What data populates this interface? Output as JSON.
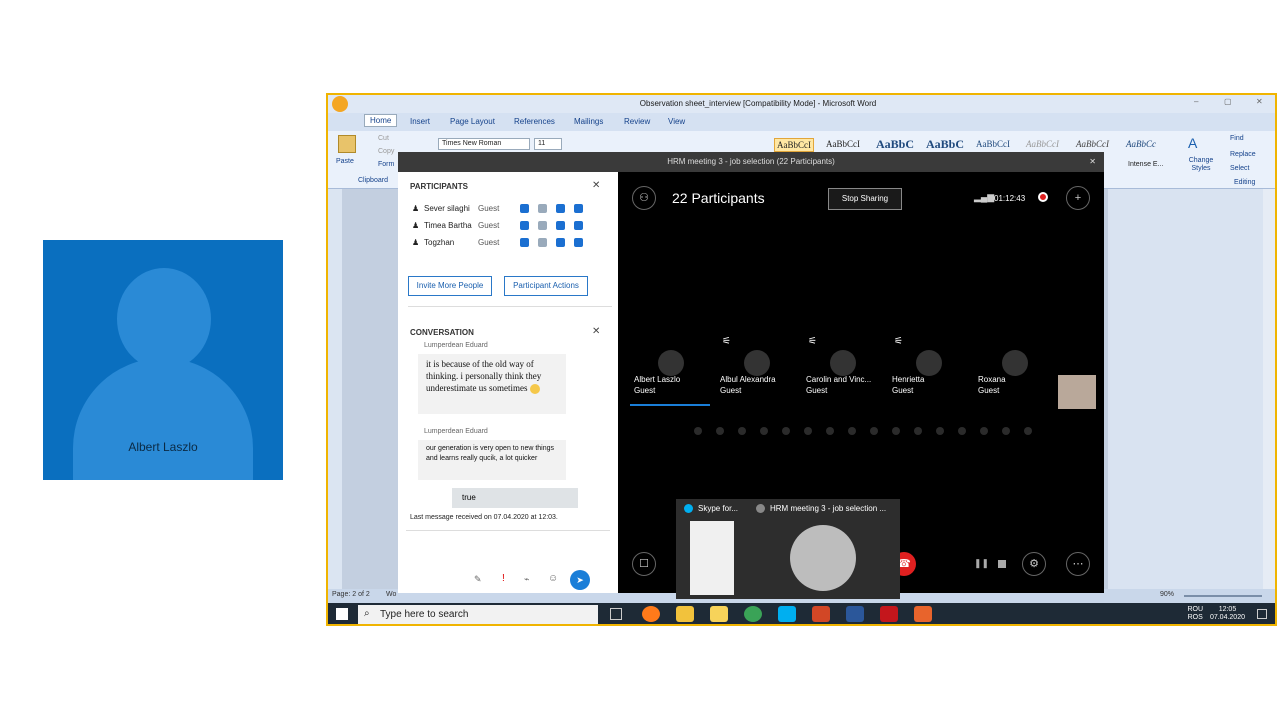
{
  "presenter": {
    "name": "Albert Laszlo"
  },
  "word": {
    "title": "Observation sheet_interview [Compatibility Mode] - Microsoft Word",
    "tabs": [
      "Home",
      "Insert",
      "Page Layout",
      "References",
      "Mailings",
      "Review",
      "View"
    ],
    "paste": "Paste",
    "cut": "Cut",
    "copy": "Copy",
    "format": "Form",
    "clipboard": "Clipboard",
    "font_name": "Times New Roman",
    "font_size": "11",
    "style_samples": [
      "AaBbCcI",
      "AaBbCcI",
      "AaBbC",
      "AaBbC",
      "AaBbCcI",
      "AaBbCcI",
      "AaBbCcI",
      "AaBbCc"
    ],
    "intense_label": "Intense E...",
    "change_styles": "Change Styles",
    "find": "Find",
    "replace": "Replace",
    "select": "Select",
    "editing": "Editing",
    "status_page": "Page: 2 of 2",
    "status_words": "Wo",
    "zoom": "90%"
  },
  "skype": {
    "title": "HRM meeting 3 - job selection (22 Participants)",
    "participants_header": "PARTICIPANTS",
    "participants": [
      {
        "name": "Sever silaghi",
        "role": "Guest"
      },
      {
        "name": "Timea Bartha",
        "role": "Guest"
      },
      {
        "name": "Togzhan",
        "role": "Guest"
      }
    ],
    "invite": "Invite More People",
    "actions": "Participant Actions",
    "conversation_header": "CONVERSATION",
    "messages": [
      {
        "sender": "Lumperdean Eduard",
        "text": "it is because of the old way of thinking. i personally think they underestimate us sometimes"
      },
      {
        "sender": "Lumperdean Eduard",
        "text": "our generation is very open to new things and learns really qucik, a lot quicker"
      }
    ],
    "own_message": "true",
    "last_message": "Last message received on 07.04.2020 at 12:03.",
    "participant_count": "22 Participants",
    "stop_sharing": "Stop Sharing",
    "call_time": "01:12:43",
    "tiles": [
      {
        "name": "Albert Laszlo",
        "role": "Guest",
        "muted": false
      },
      {
        "name": "Albul Alexandra",
        "role": "Guest",
        "muted": true
      },
      {
        "name": "Carolin and Vinc...",
        "role": "Guest",
        "muted": true
      },
      {
        "name": "Henrietta",
        "role": "Guest",
        "muted": true
      },
      {
        "name": "Roxana",
        "role": "Guest",
        "muted": false
      }
    ]
  },
  "taskbar": {
    "search_placeholder": "Type here to search",
    "preview_left": "Skype for...",
    "preview_right": "HRM meeting 3 - job selection ...",
    "lang_top": "ROU",
    "lang_bottom": "ROS",
    "time": "12:05",
    "date": "07.04.2020"
  },
  "colors": {
    "skype_blue": "#0a6fbf",
    "accent_border": "#f0b400",
    "hangup": "#e02020"
  }
}
